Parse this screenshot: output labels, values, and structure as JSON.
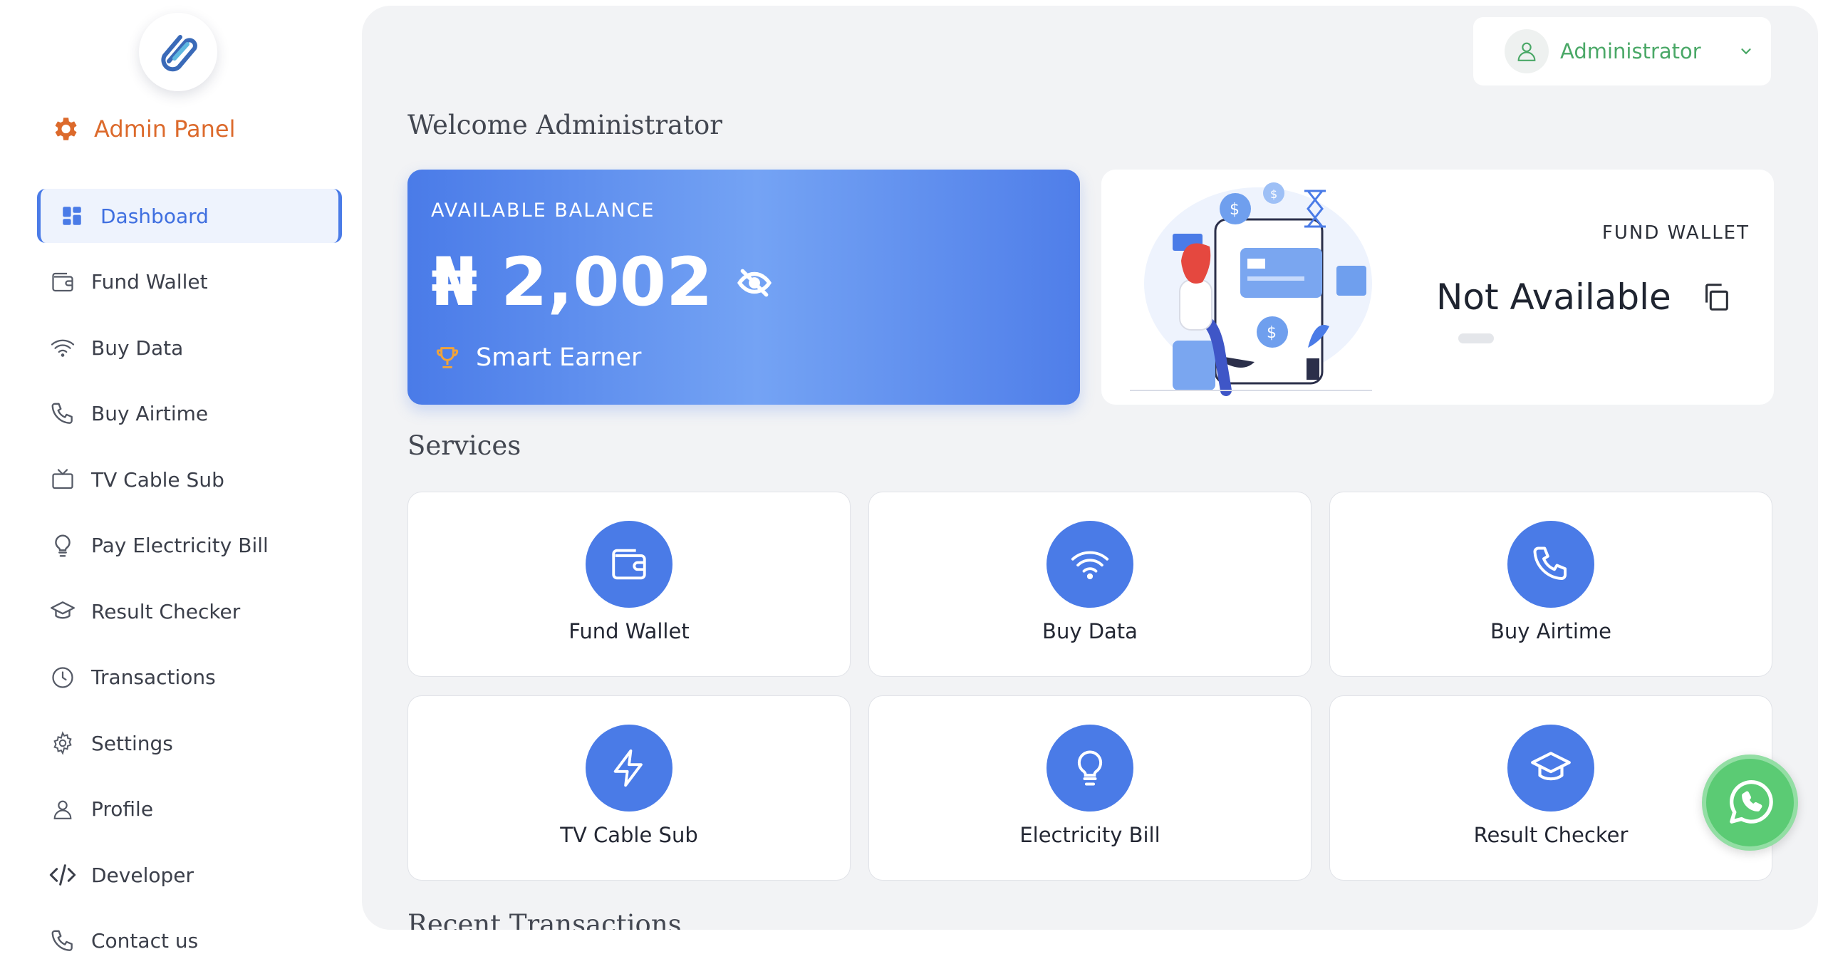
{
  "sidebar": {
    "brand": "Admin Panel",
    "items": [
      {
        "label": "Dashboard",
        "icon": "dashboard-icon"
      },
      {
        "label": "Fund Wallet",
        "icon": "wallet-icon"
      },
      {
        "label": "Buy Data",
        "icon": "wifi-icon"
      },
      {
        "label": "Buy Airtime",
        "icon": "phone-icon"
      },
      {
        "label": "TV Cable Sub",
        "icon": "tv-icon"
      },
      {
        "label": "Pay Electricity Bill",
        "icon": "bulb-icon"
      },
      {
        "label": "Result Checker",
        "icon": "graduation-cap-icon"
      },
      {
        "label": "Transactions",
        "icon": "clock-icon"
      },
      {
        "label": "Settings",
        "icon": "gear-icon"
      },
      {
        "label": "Profile",
        "icon": "user-icon"
      },
      {
        "label": "Developer",
        "icon": "code-icon"
      },
      {
        "label": "Contact us",
        "icon": "phone-icon"
      }
    ]
  },
  "header": {
    "user_name": "Administrator"
  },
  "main": {
    "welcome": "Welcome Administrator",
    "balance": {
      "label": "AVAILABLE BALANCE",
      "amount": "₦ 2,002",
      "tier": "Smart Earner"
    },
    "fund_wallet": {
      "label": "FUND WALLET",
      "value": "Not Available"
    },
    "services_title": "Services",
    "services": [
      {
        "label": "Fund Wallet",
        "icon": "wallet-icon"
      },
      {
        "label": "Buy Data",
        "icon": "wifi-icon"
      },
      {
        "label": "Buy Airtime",
        "icon": "phone-icon"
      },
      {
        "label": "TV Cable Sub",
        "icon": "lightning-icon"
      },
      {
        "label": "Electricity Bill",
        "icon": "bulb-icon"
      },
      {
        "label": "Result Checker",
        "icon": "graduation-cap-icon"
      }
    ],
    "recent_title": "Recent Transactions"
  },
  "colors": {
    "accent": "#4a7be7",
    "brand": "#dc6a2c",
    "user": "#4aa867",
    "whatsapp": "#5bcb74"
  }
}
